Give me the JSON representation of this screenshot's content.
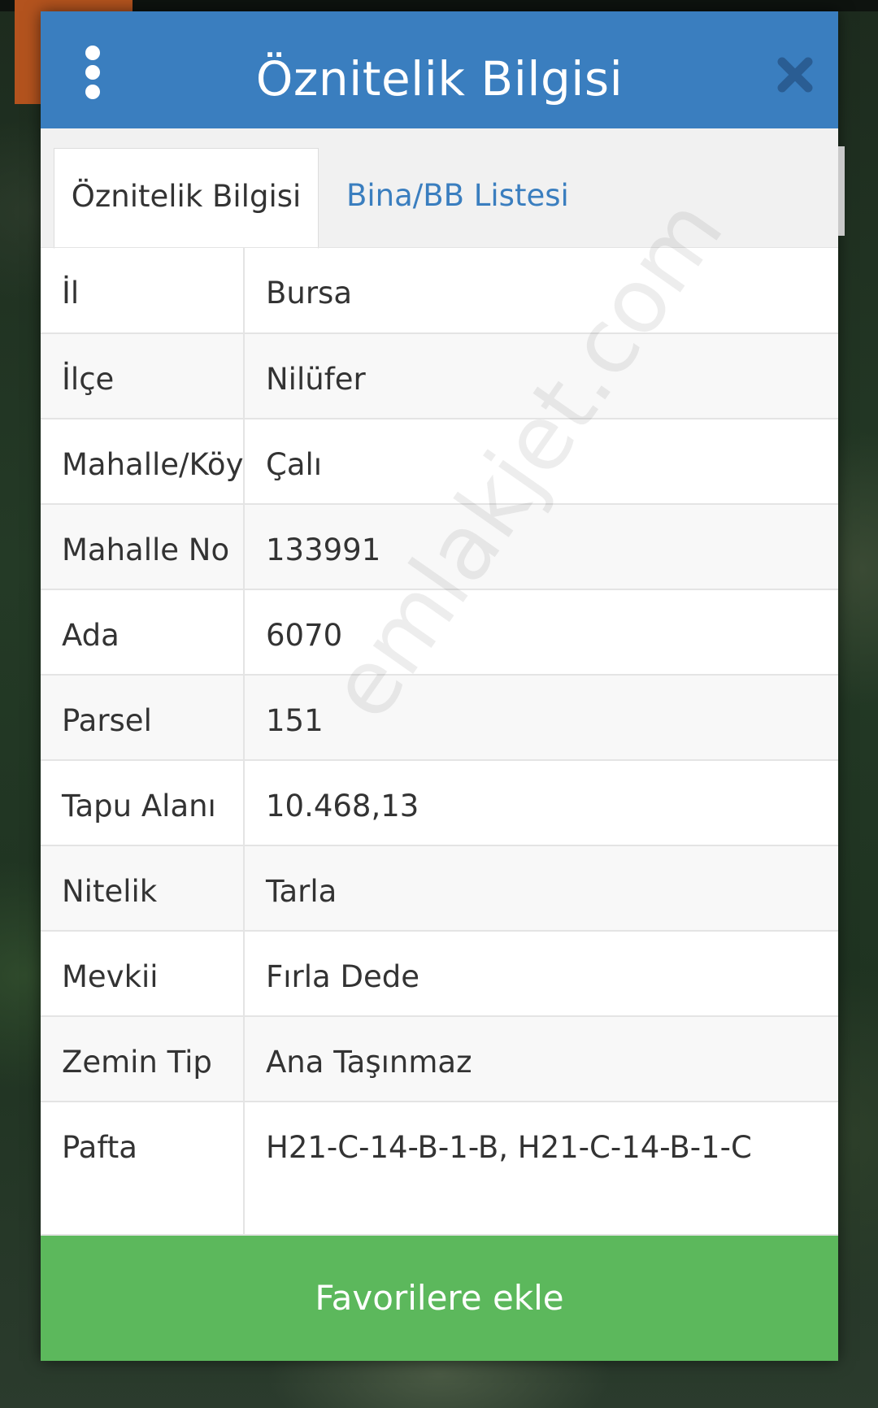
{
  "dialog": {
    "title": "Öznitelik Bilgisi"
  },
  "tabs": [
    {
      "label": "Öznitelik Bilgisi",
      "active": true
    },
    {
      "label": "Bina/BB Listesi",
      "active": false
    }
  ],
  "attributes": [
    {
      "key": "İl",
      "value": "Bursa"
    },
    {
      "key": "İlçe",
      "value": "Nilüfer"
    },
    {
      "key": "Mahalle/Köy",
      "value": "Çalı"
    },
    {
      "key": "Mahalle No",
      "value": "133991"
    },
    {
      "key": "Ada",
      "value": "6070"
    },
    {
      "key": "Parsel",
      "value": "151"
    },
    {
      "key": "Tapu Alanı",
      "value": "10.468,13"
    },
    {
      "key": "Nitelik",
      "value": "Tarla"
    },
    {
      "key": "Mevkii",
      "value": "Fırla Dede"
    },
    {
      "key": "Zemin Tip",
      "value": "Ana Taşınmaz"
    },
    {
      "key": "Pafta",
      "value": "H21-C-14-B-1-B, H21-C-14-B-1-C"
    }
  ],
  "actions": {
    "favorite_label": "Favorilere ekle"
  },
  "watermark": "emlakjet.com",
  "colors": {
    "header": "#3a7ebf",
    "tab_link": "#3a7ebf",
    "favorite_button": "#5cb85c"
  },
  "icons": {
    "menu": "vertical-dots-icon",
    "close": "close-icon"
  }
}
